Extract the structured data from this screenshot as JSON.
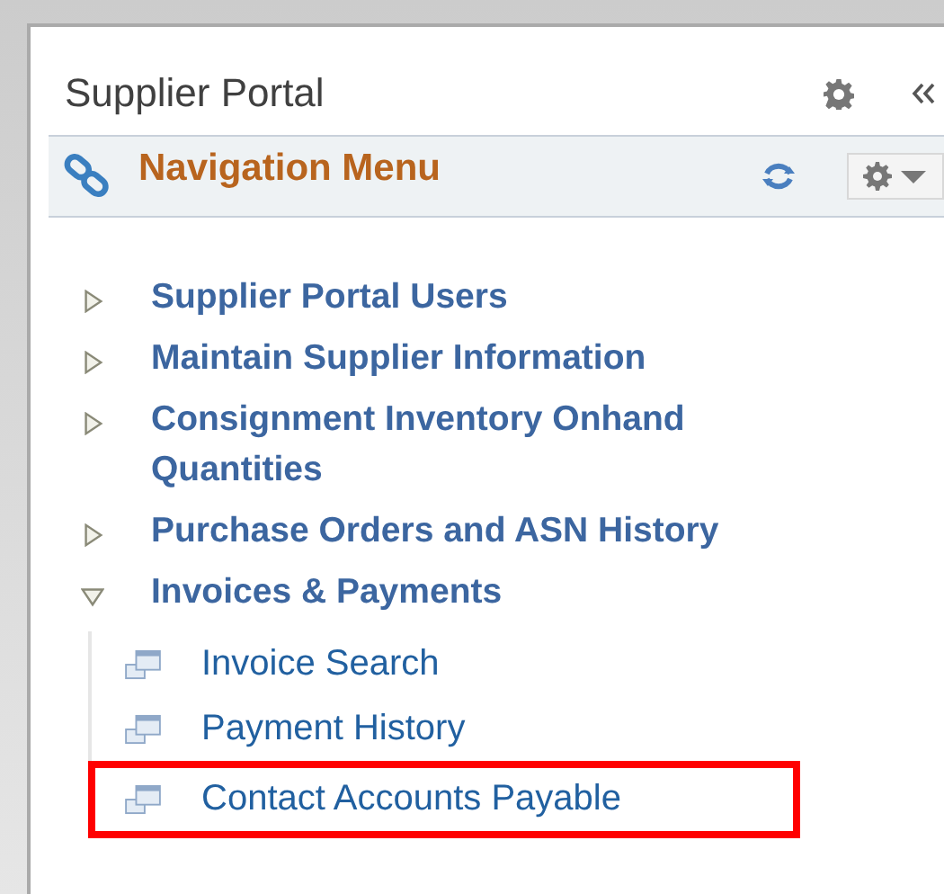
{
  "panel": {
    "title": "Supplier Portal"
  },
  "navigation": {
    "title": "Navigation Menu",
    "items": [
      {
        "label": "Supplier Portal Users",
        "expanded": false
      },
      {
        "label": "Maintain Supplier Information",
        "expanded": false
      },
      {
        "label": "Consignment Inventory Onhand Quantities",
        "expanded": false
      },
      {
        "label": "Purchase Orders and ASN History",
        "expanded": false
      },
      {
        "label": "Invoices & Payments",
        "expanded": true,
        "children": [
          {
            "label": "Invoice Search",
            "highlighted": false
          },
          {
            "label": "Payment History",
            "highlighted": false
          },
          {
            "label": "Contact Accounts Payable",
            "highlighted": true
          }
        ]
      }
    ]
  }
}
